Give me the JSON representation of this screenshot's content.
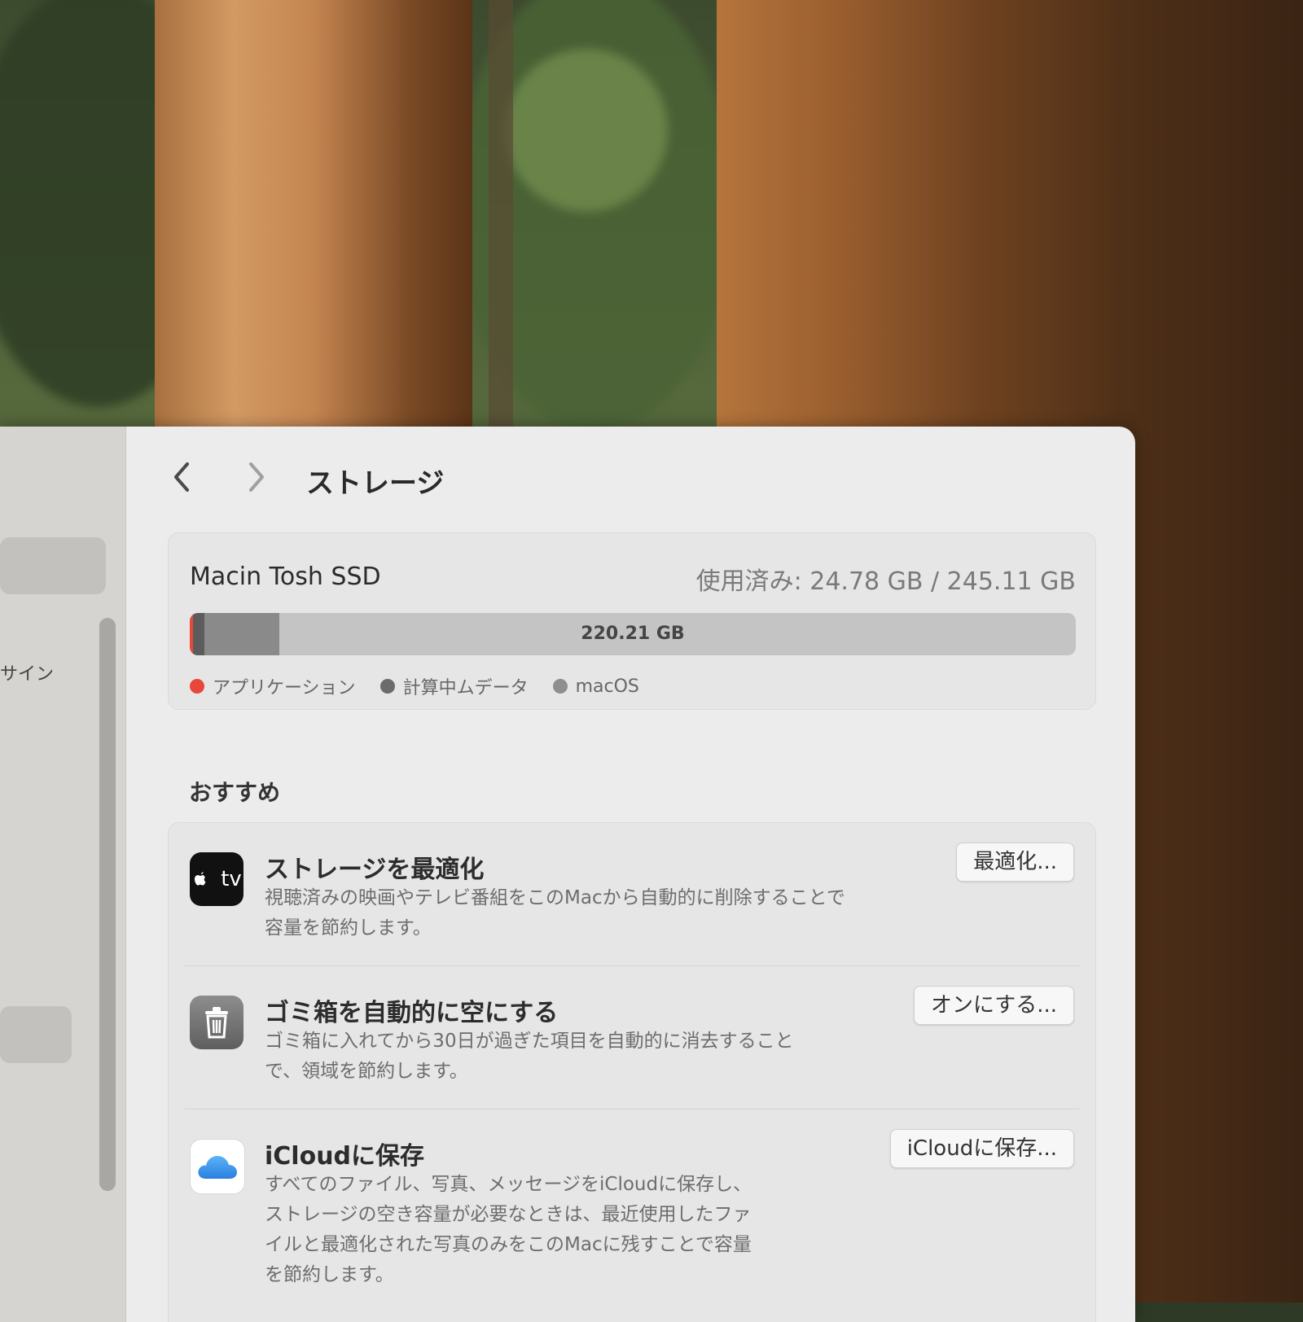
{
  "window": {
    "title": "ストレージ",
    "back_icon": "chevron-left-icon",
    "forward_icon": "chevron-right-icon"
  },
  "sidebar": {
    "partial_item_label": "サイン"
  },
  "storage": {
    "disk_name": "Macin Tosh SSD",
    "used_label": "使用済み: 24.78 GB / 245.11 GB",
    "free_label": "220.21 GB",
    "used_fraction": 0.101,
    "legend": [
      {
        "label": "アプリケーション",
        "color": "#e8483b"
      },
      {
        "label": "計算中ムデータ",
        "color": "#6b6b6b"
      },
      {
        "label": "macOS",
        "color": "#8e8e8e"
      }
    ],
    "colors": {
      "apps": "#e8483b",
      "data": "#5c5c5c",
      "macos": "#8a8a8a",
      "free": "#c4c4c4"
    }
  },
  "recommendations": {
    "heading": "おすすめ",
    "items": [
      {
        "icon": "apple-tv-icon",
        "icon_text": "tv",
        "title": "ストレージを最適化",
        "desc_line1": "視聴済みの映画やテレビ番組をこのMacから自動的に削除することで",
        "desc_line2": "容量を節約します。",
        "button": "最適化..."
      },
      {
        "icon": "trash-icon",
        "title": "ゴミ箱を自動的に空にする",
        "desc_line1": "ゴミ箱に入れてから30日が過ぎた項目を自動的に消去すること",
        "desc_line2": "で、領域を節約します。",
        "button": "オンにする..."
      },
      {
        "icon": "icloud-icon",
        "title": "iCloudに保存",
        "desc_line1": "すべてのファイル、写真、メッセージをiCloudに保存し、",
        "desc_line2": "ストレージの空き容量が必要なときは、最近使用したファ",
        "desc_line3": "イルと最適化された写真のみをこのMacに残すことで容量",
        "desc_line4": "を節約します。",
        "button": "iCloudに保存..."
      }
    ]
  }
}
